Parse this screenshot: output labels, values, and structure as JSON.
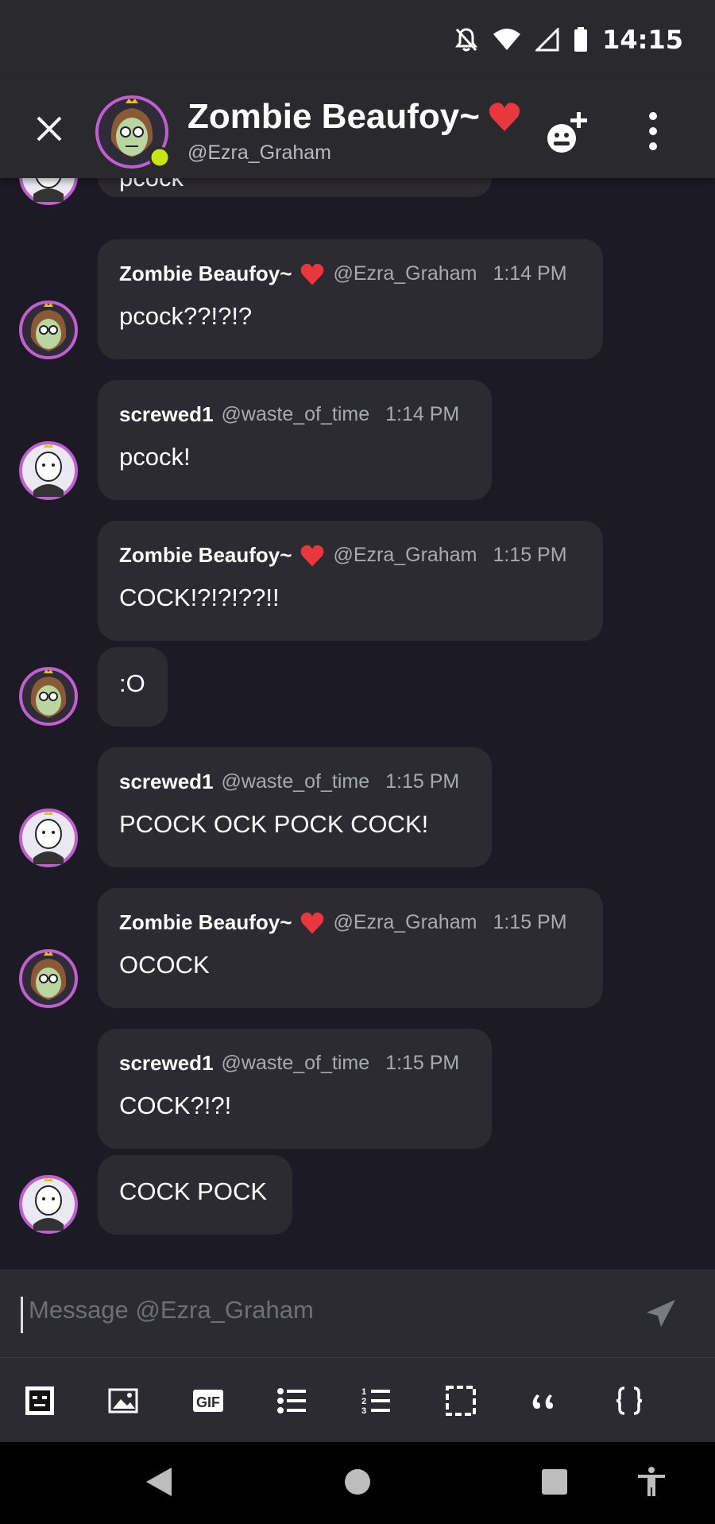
{
  "status": {
    "time": "14:15"
  },
  "header": {
    "title": "Zombie Beaufoy~",
    "subtitle": "@Ezra_Graham"
  },
  "messages": [
    {
      "name": "",
      "handle": "",
      "time": "",
      "text": "pcock"
    },
    {
      "name": "Zombie Beaufoy~",
      "handle": "@Ezra_Graham",
      "time": "1:14 PM",
      "text": "pcock??!?!?"
    },
    {
      "name": "screwed1",
      "handle": "@waste_of_time",
      "time": "1:14 PM",
      "text": "pcock!"
    },
    {
      "name": "Zombie Beaufoy~",
      "handle": "@Ezra_Graham",
      "time": "1:15 PM",
      "text": "COCK!?!?!??!!"
    },
    {
      "text": ":O"
    },
    {
      "name": "screwed1",
      "handle": "@waste_of_time",
      "time": "1:15 PM",
      "text": "PCOCK OCK POCK COCK!"
    },
    {
      "name": "Zombie Beaufoy~",
      "handle": "@Ezra_Graham",
      "time": "1:15 PM",
      "text": "OCOCK"
    },
    {
      "name": "screwed1",
      "handle": "@waste_of_time",
      "time": "1:15 PM",
      "text": "COCK?!?!"
    },
    {
      "text": "COCK POCK"
    }
  ],
  "composer": {
    "placeholder": "Message @Ezra_Graham"
  },
  "toolbar": {
    "gif_label": "GIF"
  },
  "colors": {
    "heart": "#e8373d",
    "online": "#c8e614",
    "avatar_ring": "#c05fd0"
  }
}
